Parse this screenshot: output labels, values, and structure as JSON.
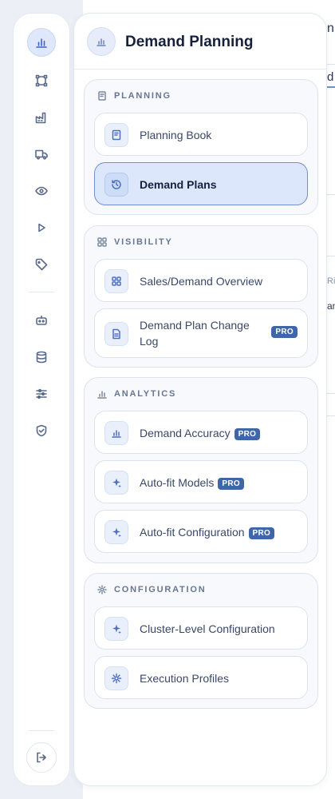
{
  "rail": {
    "items": [
      {
        "icon": "bar-chart-icon",
        "active": true
      },
      {
        "icon": "network-icon",
        "active": false
      },
      {
        "icon": "factory-icon",
        "active": false
      },
      {
        "icon": "truck-icon",
        "active": false
      },
      {
        "icon": "eye-icon",
        "active": false
      },
      {
        "icon": "play-icon",
        "active": false
      },
      {
        "icon": "tag-icon",
        "active": false
      },
      {
        "icon": "robot-icon",
        "active": false
      },
      {
        "icon": "database-icon",
        "active": false
      },
      {
        "icon": "sliders-icon",
        "active": false
      },
      {
        "icon": "shield-check-icon",
        "active": false
      }
    ],
    "logout_icon": "logout-icon"
  },
  "panel": {
    "title": "Demand Planning",
    "groups": [
      {
        "label": "PLANNING",
        "items": [
          {
            "label": "Planning Book",
            "pro": false,
            "active": false
          },
          {
            "label": "Demand Plans",
            "pro": false,
            "active": true
          }
        ]
      },
      {
        "label": "VISIBILITY",
        "items": [
          {
            "label": "Sales/Demand Overview",
            "pro": false,
            "active": false
          },
          {
            "label": "Demand Plan Change Log",
            "pro": true,
            "active": false
          }
        ]
      },
      {
        "label": "ANALYTICS",
        "items": [
          {
            "label": "Demand Accuracy",
            "pro": true,
            "active": false
          },
          {
            "label": "Auto-fit Models",
            "pro": true,
            "active": false
          },
          {
            "label": "Auto-fit Configuration",
            "pro": true,
            "active": false
          }
        ]
      },
      {
        "label": "CONFIGURATION",
        "items": [
          {
            "label": "Cluster-Level Configuration",
            "pro": false,
            "active": false
          },
          {
            "label": "Execution Profiles",
            "pro": false,
            "active": false
          }
        ]
      }
    ],
    "pro_badge": "PRO"
  },
  "background": {
    "fragments": [
      "n",
      "d",
      "Ri",
      "an"
    ]
  },
  "colors": {
    "accent": "#3c63c9",
    "active_bg": "#dce7fb",
    "pro_badge": "#3f66a8"
  }
}
